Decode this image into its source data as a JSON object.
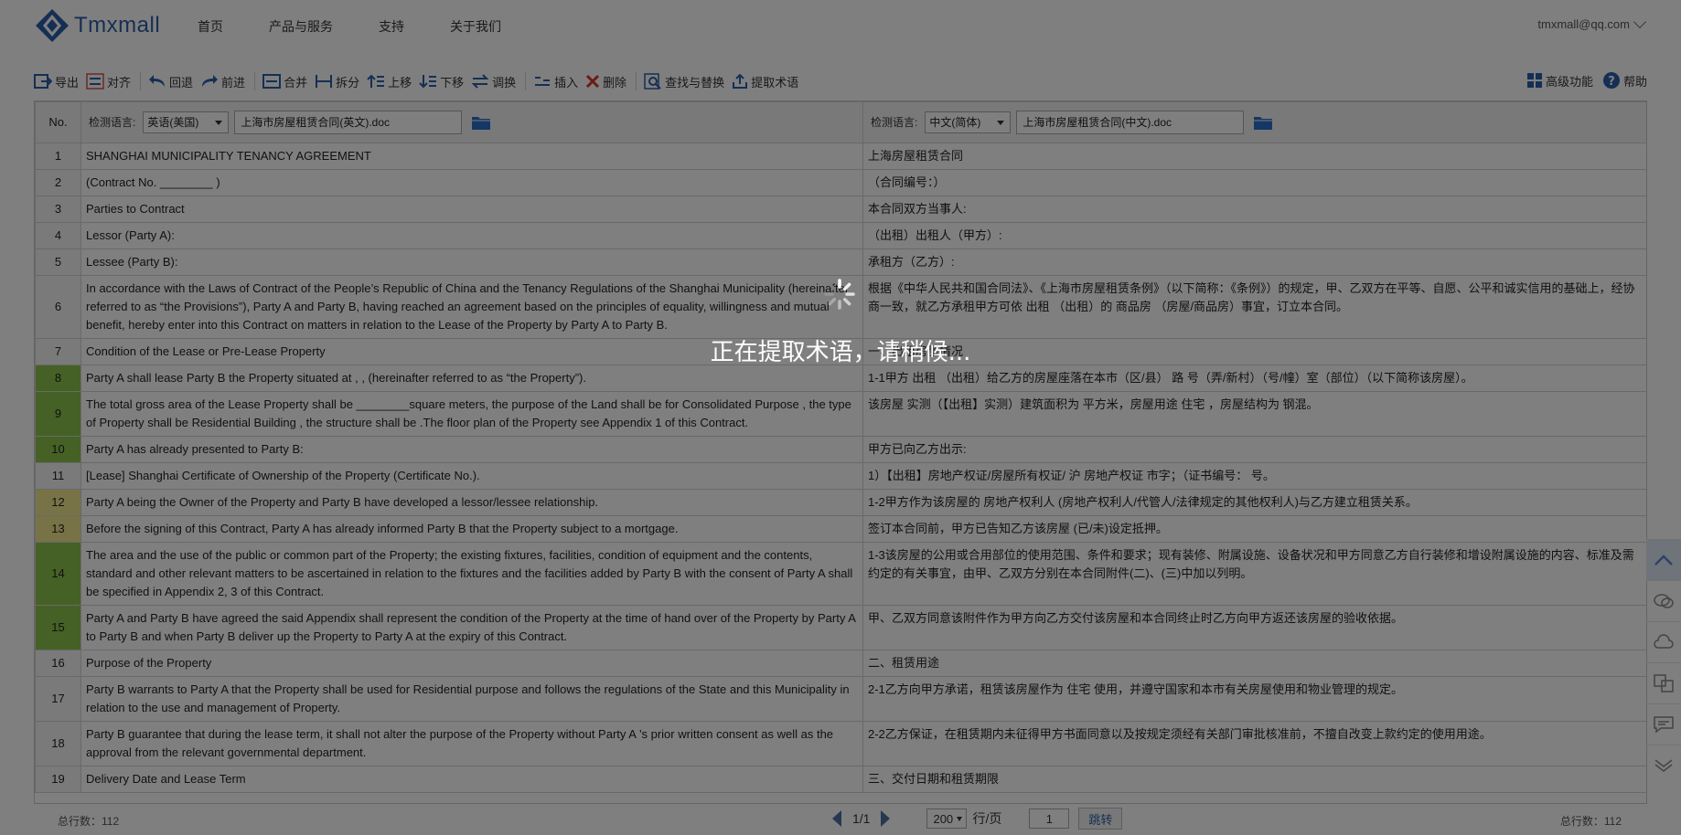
{
  "header": {
    "logo_text": "Tmxmall",
    "nav": [
      "首页",
      "产品与服务",
      "支持",
      "关于我们"
    ],
    "user": "tmxmall@qq.com"
  },
  "toolbar": {
    "items": [
      {
        "label": "导出",
        "icon": "export-icon"
      },
      {
        "label": "对齐",
        "icon": "align-icon"
      },
      {
        "label": "回退",
        "icon": "undo-icon"
      },
      {
        "label": "前进",
        "icon": "redo-icon"
      },
      {
        "label": "合并",
        "icon": "merge-icon"
      },
      {
        "label": "拆分",
        "icon": "split-icon"
      },
      {
        "label": "上移",
        "icon": "move-up-icon"
      },
      {
        "label": "下移",
        "icon": "move-down-icon"
      },
      {
        "label": "调换",
        "icon": "swap-icon"
      },
      {
        "label": "插入",
        "icon": "insert-icon"
      },
      {
        "label": "删除",
        "icon": "delete-icon"
      },
      {
        "label": "查找与替换",
        "icon": "find-replace-icon"
      },
      {
        "label": "提取术语",
        "icon": "extract-terms-icon"
      }
    ],
    "advanced": "高级功能",
    "help": "帮助"
  },
  "table": {
    "no_header": "No.",
    "left": {
      "detect_label": "检测语言:",
      "language": "英语(美国)",
      "file": "上海市房屋租赁合同(英文).doc"
    },
    "right": {
      "detect_label": "检测语言:",
      "language": "中文(简体)",
      "file": "上海市房屋租赁合同(中文).doc"
    },
    "rows": [
      {
        "no": "1",
        "status": "",
        "en": "SHANGHAI MUNICIPALITY TENANCY AGREEMENT",
        "zh": "上海房屋租赁合同"
      },
      {
        "no": "2",
        "status": "",
        "en": "(Contract No. ________ )",
        "zh": "（合同编号：）"
      },
      {
        "no": "3",
        "status": "",
        "en": "Parties to Contract",
        "zh": "本合同双方当事人:"
      },
      {
        "no": "4",
        "status": "",
        "en": "Lessor (Party A):",
        "zh": "（出租）出租人（甲方）:"
      },
      {
        "no": "5",
        "status": "",
        "en": "Lessee (Party B):",
        "zh": "承租方（乙方）:"
      },
      {
        "no": "6",
        "status": "",
        "en": "In accordance with the Laws of Contract of the People’s Republic of China and the Tenancy Regulations of the Shanghai Municipality (hereinafter referred to as “the Provisions”), Party A and Party B, having reached an agreement based on the principles of equality, willingness and mutual benefit, hereby enter into this Contract on matters in relation to the Lease of the Property by Party A to Party B.",
        "zh": "根据《中华人民共和国合同法》、《上海市房屋租赁条例》（以下简称：《条例》）的规定，甲、乙双方在平等、自愿、公平和诚实信用的基础上，经协商一致，就乙方承租甲方可依 出租 （出租）的 商品房 （房屋/商品房）事宜，订立本合同。"
      },
      {
        "no": "7",
        "status": "",
        "en": "Condition of the Lease or Pre-Lease Property",
        "zh": "一、出租房屋情况"
      },
      {
        "no": "8",
        "status": "ok",
        "en": "Party A shall lease Party B the Property situated at , , (hereinafter referred to as “the Property”).",
        "zh": "1-1甲方 出租 （出租）给乙方的房屋座落在本市（区/县） 路 号（弄/新村）（号/幢）室（部位）（以下简称该房屋）。"
      },
      {
        "no": "9",
        "status": "ok",
        "en": "The total gross area of the Lease Property shall be ________square meters, the purpose of the Land shall be for Consolidated Purpose , the type of Property shall be Residential Building , the structure shall be .The floor plan of the Property see Appendix 1 of this Contract.",
        "zh": "该房屋 实测（【出租】实测）建筑面积为 平方米，房屋用途 住宅 ，房屋结构为 钢混。"
      },
      {
        "no": "10",
        "status": "ok",
        "en": "Party A has already presented to Party B:",
        "zh": "甲方已向乙方出示:"
      },
      {
        "no": "11",
        "status": "",
        "en": "[Lease] Shanghai Certificate of Ownership of the Property (Certificate No.).",
        "zh": "1）【出租】房地产权证/房屋所有权证/ 沪 房地产权证 市字；（证书编号： 号。"
      },
      {
        "no": "12",
        "status": "warn",
        "en": "Party A being the Owner of the Property and Party B have developed a lessor/lessee relationship.",
        "zh": "1-2甲方作为该房屋的 房地产权利人 (房地产权利人/代管人/法律规定的其他权利人)与乙方建立租赁关系。"
      },
      {
        "no": "13",
        "status": "warn",
        "en": "Before the signing of this Contract, Party A has already informed Party B that the Property subject to a mortgage.",
        "zh": "签订本合同前，甲方已告知乙方该房屋 (已/未)设定抵押。"
      },
      {
        "no": "14",
        "status": "ok",
        "en": "The area and the use of the public or common part of the Property; the existing fixtures, facilities, condition of equipment and the contents, standard and other relevant matters to be ascertained in relation to the fixtures and the facilities added by Party B with the consent of Party A shall be specified in Appendix 2, 3 of this Contract.",
        "zh": "1-3该房屋的公用或合用部位的使用范围、条件和要求；现有装修、附属设施、设备状况和甲方同意乙方自行装修和增设附属设施的内容、标准及需约定的有关事宜，由甲、乙双方分别在本合同附件(二)、(三)中加以列明。"
      },
      {
        "no": "15",
        "status": "ok",
        "en": "Party A and Party B have agreed the said Appendix shall represent the condition of the Property at the time of hand over of the Property by Party A to Party B and when Party B deliver up the Property to Party A at the expiry of this Contract.",
        "zh": "甲、乙双方同意该附件作为甲方向乙方交付该房屋和本合同终止时乙方向甲方返还该房屋的验收依据。"
      },
      {
        "no": "16",
        "status": "",
        "en": "Purpose of the Property",
        "zh": "二、租赁用途"
      },
      {
        "no": "17",
        "status": "",
        "en": "Party B warrants to Party A that the Property shall be used for Residential purpose and follows the regulations of the State and this Municipality in relation to the use and management of Property.",
        "zh": "2-1乙方向甲方承诺，租赁该房屋作为 住宅 使用，并遵守国家和本市有关房屋使用和物业管理的规定。"
      },
      {
        "no": "18",
        "status": "",
        "en": "Party B guarantee that during the lease term, it shall not alter the purpose of the Property without Party A ’s prior written consent as well as the approval from the relevant governmental department.",
        "zh": "2-2乙方保证，在租赁期内未征得甲方书面同意以及按规定须经有关部门审批核准前，不擅自改变上款约定的使用用途。"
      },
      {
        "no": "19",
        "status": "",
        "en": "Delivery Date and Lease Term",
        "zh": "三、交付日期和租赁期限"
      }
    ]
  },
  "footer": {
    "left_total": "总行数：112",
    "right_total": "总行数：112",
    "page": "1/1",
    "page_size": "200",
    "per_page_label": "行/页",
    "page_input": "1",
    "go_label": "跳转"
  },
  "overlay": {
    "text": "正在提取术语，请稍候..."
  },
  "colors": {
    "brand": "#2a5ea8",
    "status_ok": "#8bc34a",
    "status_warn": "#f0e68c"
  }
}
